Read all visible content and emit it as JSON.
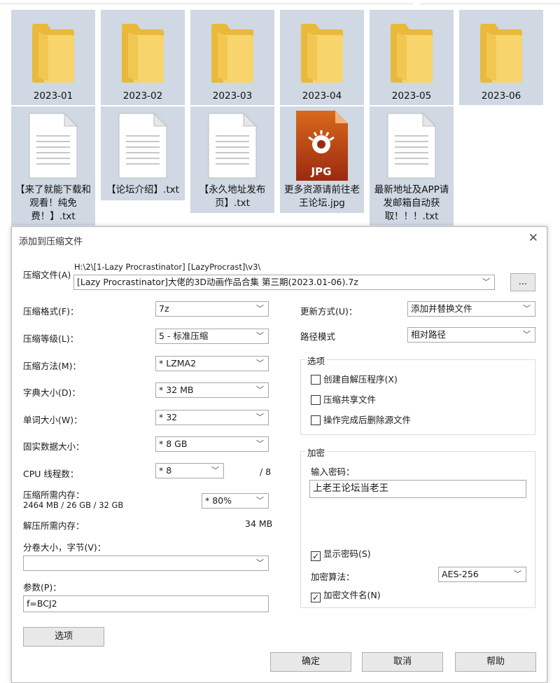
{
  "folders": [
    "2023-01",
    "2023-02",
    "2023-03",
    "2023-04",
    "2023-05",
    "2023-06"
  ],
  "files": [
    {
      "name": "【来了就能下载和观看！纯免费！】.txt",
      "type": "txt"
    },
    {
      "name": "【论坛介绍】.txt",
      "type": "txt"
    },
    {
      "name": "【永久地址发布页】.txt",
      "type": "txt"
    },
    {
      "name": "更多资源请前往老王论坛.jpg",
      "type": "jpg",
      "icon_text": "JPG"
    },
    {
      "name": "最新地址及APP请发邮箱自动获取！！！.txt",
      "type": "txt"
    }
  ],
  "dialog": {
    "title": "添加到压缩文件",
    "archive_label": "压缩文件(A)",
    "archive_path": "H:\\2\\[1-Lazy Procrastinator] [LazyProcrast]\\v3\\",
    "archive_name": "[Lazy Procrastinator]大佬的3D动画作品合集 第三期(2023.01-06).7z",
    "browse_label": "...",
    "format_label": "压缩格式(F)：",
    "format_value": "7z",
    "level_label": "压缩等级(L)：",
    "level_value": "5 - 标准压缩",
    "method_label": "压缩方法(M)：",
    "method_value": "* LZMA2",
    "dict_label": "字典大小(D)：",
    "dict_value": "* 32 MB",
    "word_label": "单词大小(W)：",
    "word_value": "* 32",
    "solid_label": "固实数据大小：",
    "solid_value": "* 8 GB",
    "cpu_label": "CPU 线程数：",
    "cpu_value": "* 8",
    "cpu_total": "/ 8",
    "mem_comp_label": "压缩所需内存：",
    "mem_comp_info": "2464 MB / 26 GB / 32 GB",
    "mem_comp_value": "* 80%",
    "mem_decomp_label": "解压所需内存：",
    "mem_decomp_value": "34 MB",
    "volume_label": "分卷大小，字节(V)：",
    "volume_value": "",
    "params_label": "参数(P)：",
    "params_value": "f=BCJ2",
    "options_button": "选项",
    "update_label": "更新方式(U)：",
    "update_value": "添加并替换文件",
    "path_label": "路径模式",
    "path_value": "相对路径",
    "options_group": "选项",
    "opt_sfx": "创建自解压程序(X)",
    "opt_shared": "压缩共享文件",
    "opt_delete": "操作完成后删除源文件",
    "enc_group": "加密",
    "pwd_label": "输入密码：",
    "pwd_value": "上老王论坛当老王",
    "show_pwd": "显示密码(S)",
    "enc_method_label": "加密算法：",
    "enc_method_value": "AES-256",
    "enc_names": "加密文件名(N)",
    "ok": "确定",
    "cancel": "取消",
    "help": "帮助"
  }
}
